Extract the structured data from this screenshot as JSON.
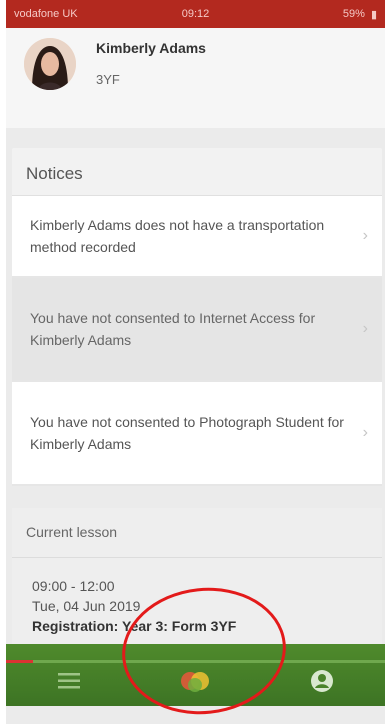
{
  "statusbar": {
    "carrier": "vodafone UK",
    "time": "09:12",
    "battery": "59%"
  },
  "student": {
    "name": "Kimberly Adams",
    "form": "3YF"
  },
  "notices": {
    "title": "Notices",
    "items": [
      {
        "text": "Kimberly Adams does not have a transportation method recorded",
        "style": "white"
      },
      {
        "text": "You have not consented to Internet Access for Kimberly Adams",
        "style": "grey"
      },
      {
        "text": "You have not consented to Photograph Student for Kimberly Adams",
        "style": "white"
      }
    ]
  },
  "current_lesson": {
    "label": "Current lesson",
    "time": "09:00 - 12:00",
    "date": "Tue, 04 Jun 2019",
    "title": "Registration: Year 3: Form 3YF"
  },
  "tabbar": {
    "tabs": [
      {
        "icon": "menu-icon"
      },
      {
        "icon": "app-logo-icon"
      },
      {
        "icon": "profile-icon"
      }
    ],
    "progress_fraction": 0.07
  },
  "colors": {
    "statusbar": "#b3291f",
    "tabbar": "#4a832a",
    "annotation": "#e31a1a"
  }
}
